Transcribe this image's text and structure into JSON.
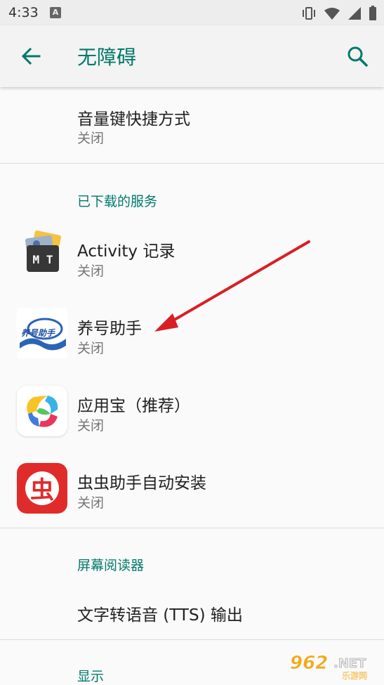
{
  "status": {
    "time": "4:33",
    "notification_label": "A"
  },
  "appbar": {
    "title": "无障碍"
  },
  "items": [
    {
      "title": "音量键快捷方式",
      "subtitle": "关闭"
    },
    {
      "title": "Activity 记录",
      "subtitle": "关闭",
      "icon_text": "M T"
    },
    {
      "title": "养号助手",
      "subtitle": "关闭",
      "icon_text": "养号助手"
    },
    {
      "title": "应用宝（推荐）",
      "subtitle": "关闭"
    },
    {
      "title": "虫虫助手自动安装",
      "subtitle": "关闭",
      "icon_text": "虫"
    },
    {
      "title": "文字转语音 (TTS) 输出"
    }
  ],
  "sections": {
    "downloaded": "已下载的服务",
    "screen_reader": "屏幕阅读器",
    "display": "显示"
  },
  "watermark": {
    "brand": "962.NET",
    "sub": "乐游网"
  },
  "colors": {
    "accent": "#00796b",
    "arrow": "#d81f26"
  }
}
